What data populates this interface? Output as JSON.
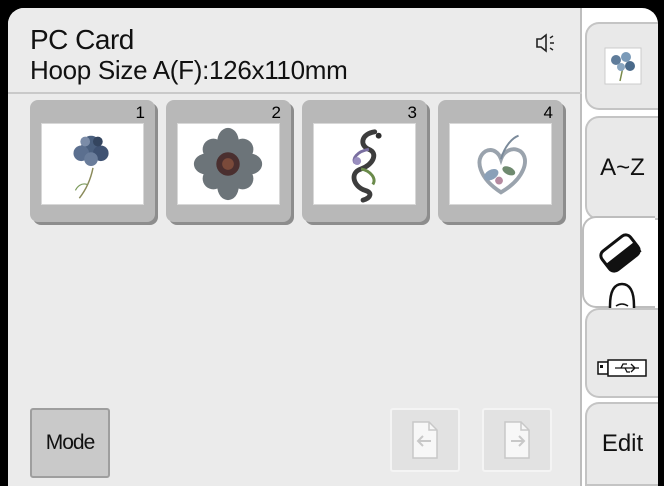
{
  "header": {
    "title": "PC Card",
    "hoop_size": "Hoop Size A(F):126x110mm",
    "sound_icon": "speaker-icon"
  },
  "designs": [
    {
      "number": "1",
      "icon": "carnation-flower-design"
    },
    {
      "number": "2",
      "icon": "round-flower-design"
    },
    {
      "number": "3",
      "icon": "swirl-ornament-design"
    },
    {
      "number": "4",
      "icon": "heart-flower-design"
    }
  ],
  "buttons": {
    "mode_label": "Mode",
    "prev_page_icon": "page-prev-icon",
    "next_page_icon": "page-next-icon"
  },
  "tabs": [
    {
      "label": "",
      "icon": "flower-design-icon"
    },
    {
      "label": "A~Z",
      "icon": ""
    },
    {
      "label": "",
      "icon": "pc-card-icon",
      "active": true
    },
    {
      "label": "",
      "icon": "usb-icon"
    },
    {
      "label": "Edit",
      "icon": ""
    }
  ],
  "colors": {
    "background": "#000000",
    "panel": "#ebebeb",
    "thumbnail": "#b8b8b8",
    "active_tab": "#ffffff"
  }
}
